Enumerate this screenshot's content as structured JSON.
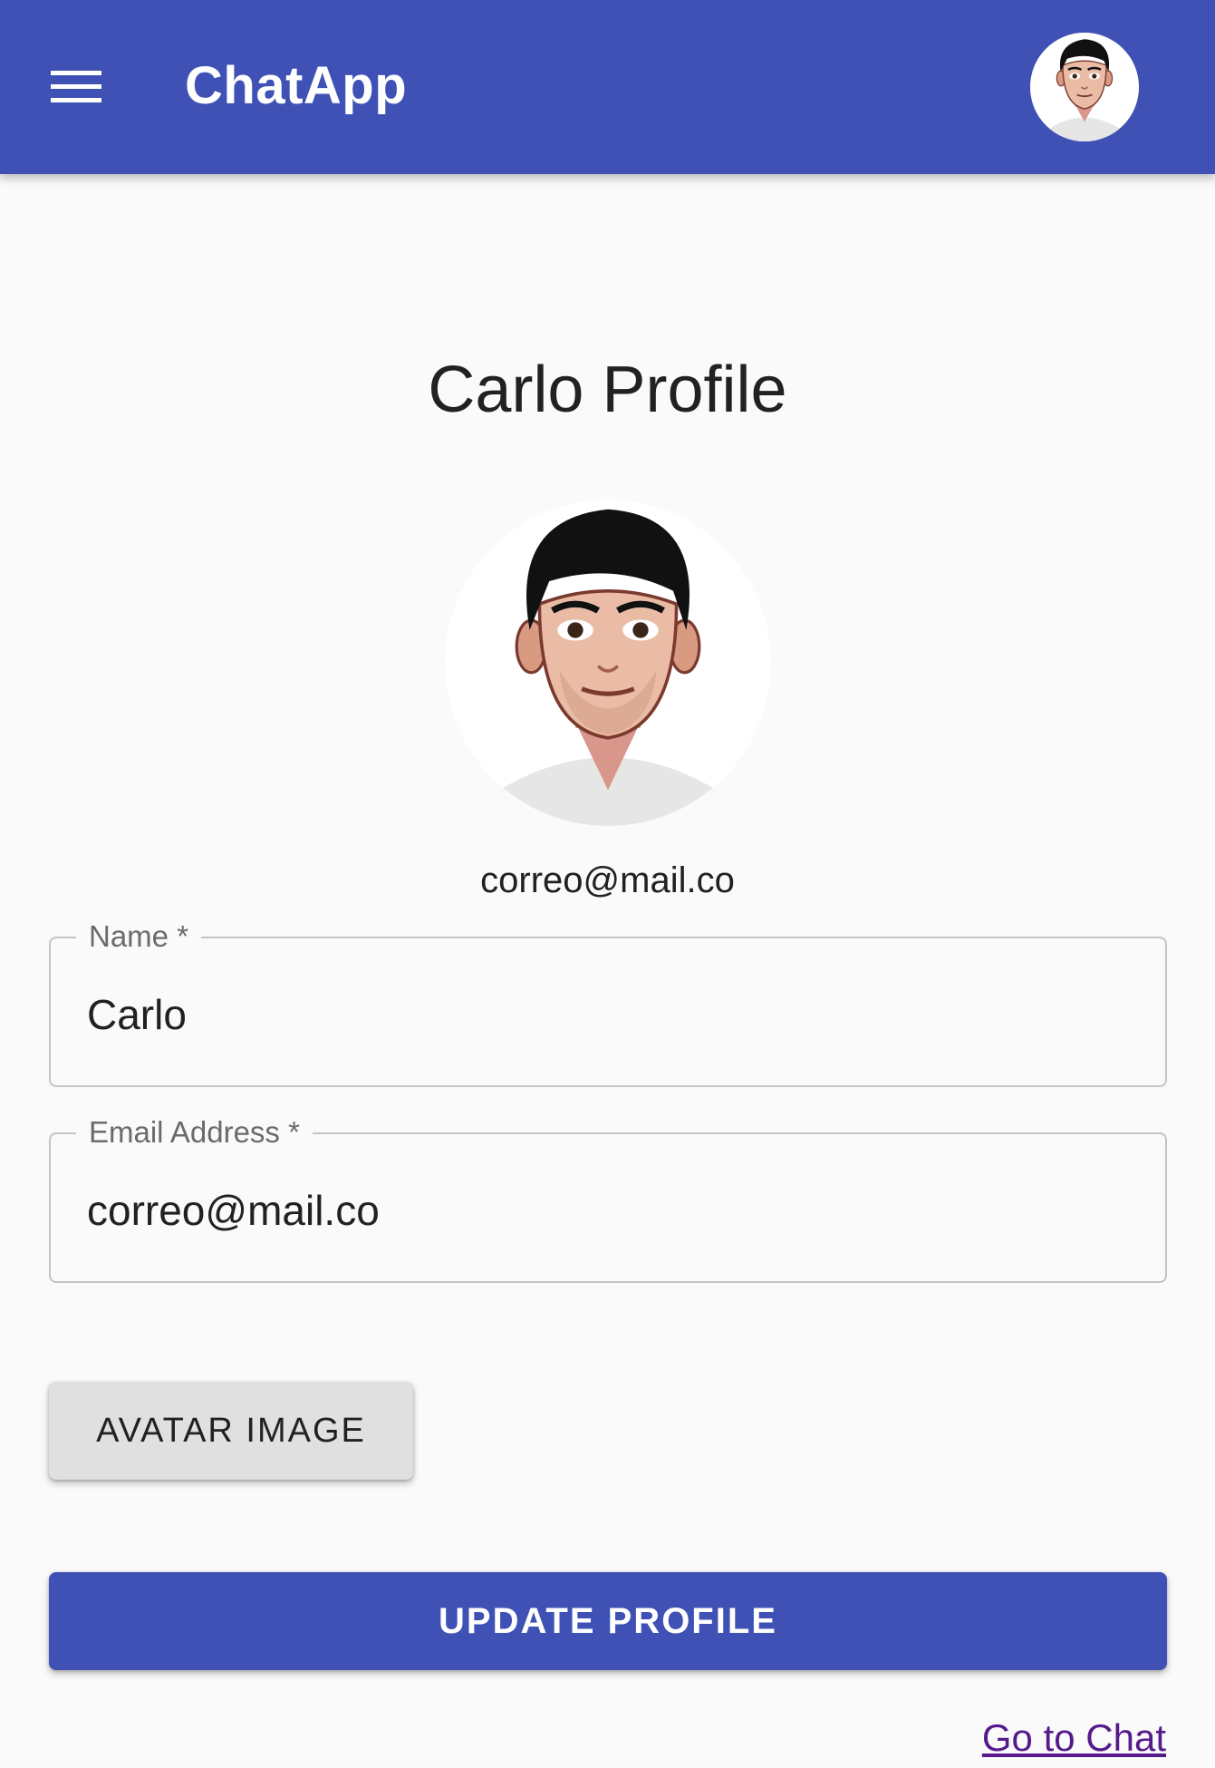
{
  "header": {
    "title": "ChatApp",
    "menu_icon": "hamburger-menu-icon",
    "avatar_icon": "user-avatar-icon"
  },
  "profile": {
    "title": "Carlo Profile",
    "avatar_icon": "cartoon-man-avatar-icon",
    "email": "correo@mail.co"
  },
  "form": {
    "name": {
      "label": "Name *",
      "value": "Carlo"
    },
    "email": {
      "label": "Email Address *",
      "value": "correo@mail.co"
    },
    "avatar_button_label": "AVATAR IMAGE",
    "update_button_label": "UPDATE PROFILE"
  },
  "links": {
    "go_to_chat": "Go to Chat"
  },
  "colors": {
    "primary": "#3f51b5",
    "background": "#fafafa",
    "secondary_button": "#e0e0e0",
    "link_visited": "#551a8b",
    "field_border": "#c4c4c4"
  }
}
